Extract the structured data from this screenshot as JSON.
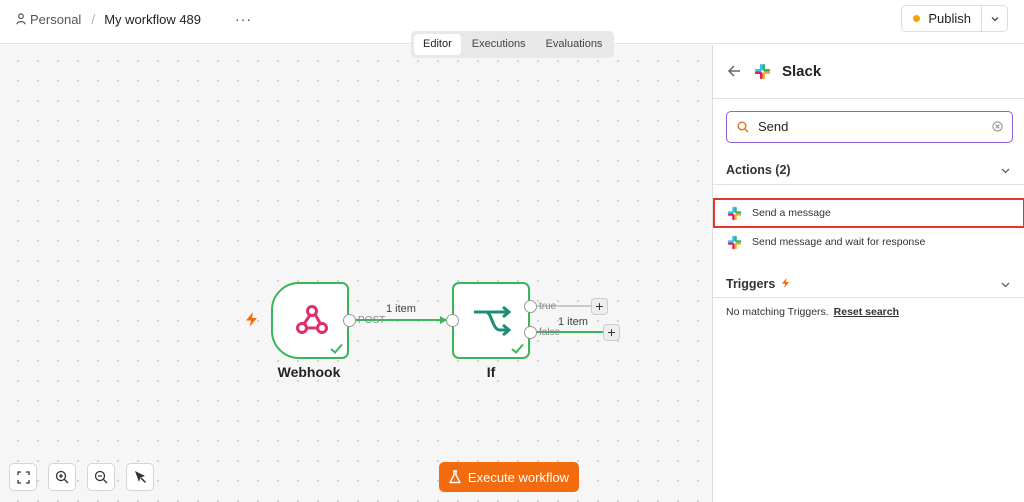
{
  "header": {
    "workspace": "Personal",
    "separator": "/",
    "workflow_name": "My workflow 489",
    "more_label": "···",
    "publish_label": "Publish",
    "publish_status_color": "#f0a30a"
  },
  "tabs": [
    {
      "label": "Editor",
      "active": true
    },
    {
      "label": "Executions",
      "active": false
    },
    {
      "label": "Evaluations",
      "active": false
    }
  ],
  "canvas": {
    "nodes": [
      {
        "name": "Webhook",
        "icon": "webhook-icon",
        "status": "success"
      },
      {
        "name": "If",
        "icon": "branch-icon",
        "status": "success"
      }
    ],
    "webhook_output_label": "POST",
    "edge_label": "1 item",
    "if_outputs": [
      {
        "label": "true",
        "items": ""
      },
      {
        "label": "false",
        "items": "1 item"
      }
    ],
    "execute_label": "Execute workflow",
    "accent_color": "#f26b0f",
    "success_color": "#3bb55a"
  },
  "panel": {
    "title": "Slack",
    "search_value": "Send",
    "actions_title": "Actions (2)",
    "actions": [
      {
        "label": "Send a message",
        "highlighted": true
      },
      {
        "label": "Send message and wait for response",
        "highlighted": false
      }
    ],
    "triggers_title": "Triggers",
    "no_triggers_text": "No matching Triggers.",
    "reset_label": "Reset search",
    "search_border_color": "#8e5fd6",
    "highlight_color": "#e8332a"
  }
}
